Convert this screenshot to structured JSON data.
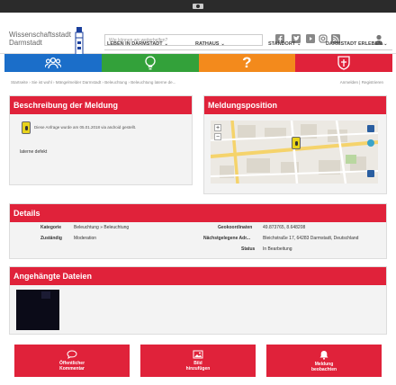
{
  "header": {
    "site_title_line1": "Wissenschaftsstadt",
    "site_title_line2": "Darmstadt",
    "search_placeholder": "Wie können wir weiterhelfen?",
    "nav": [
      "LEBEN IN DARMSTADT",
      "RATHAUS",
      "STANDORT",
      "DARMSTADT ERLEBEN"
    ],
    "social": [
      "facebook-icon",
      "twitter-icon",
      "youtube-icon",
      "instagram-icon",
      "rss-icon"
    ]
  },
  "tiles": [
    {
      "icon": "people-icon",
      "color": "#1b6ec9"
    },
    {
      "icon": "idea-icon",
      "color": "#33a13a"
    },
    {
      "icon": "question-icon",
      "color": "#f38a1c"
    },
    {
      "icon": "coat-of-arms-icon",
      "color": "#e0223a"
    }
  ],
  "breadcrumb": "Startseite › Sie ist wohl › Mängelmelder Darmstadt › Beleuchtung › Beleuchtung laterne de...",
  "login": "Anmelden | Registrieren",
  "description": {
    "title": "Beschreibung der Meldung",
    "note": "Diese Anfrage wurde am 05.01.2018 via android gestellt.",
    "text": "laterne defekt"
  },
  "position": {
    "title": "Meldungsposition"
  },
  "details": {
    "title": "Details",
    "kategorie_label": "Kategorie",
    "kategorie_value": "Beleuchtung » Beleuchtung",
    "zustaendig_label": "Zuständig",
    "zustaendig_value": "Moderation",
    "geo_label": "Geokoordinaten",
    "geo_value": "49.873765, 8.648208",
    "addr_label": "Nächstgelegene Adr...",
    "addr_value": "Bleichstraße 17, 64283 Darmstadt, Deutschland",
    "status_label": "Status",
    "status_value": "In Bearbeitung"
  },
  "files": {
    "title": "Angehängte Dateien"
  },
  "actions": [
    {
      "line1": "Öffentlicher",
      "line2": "Kommentar",
      "icon": "speech-bubble-icon"
    },
    {
      "line1": "Bild",
      "line2": "hinzufügen",
      "icon": "image-icon"
    },
    {
      "line1": "Meldung",
      "line2": "beobachten",
      "icon": "bell-icon"
    }
  ],
  "colors": {
    "primary": "#e0223a",
    "panel_bg": "#f3f3f3"
  }
}
